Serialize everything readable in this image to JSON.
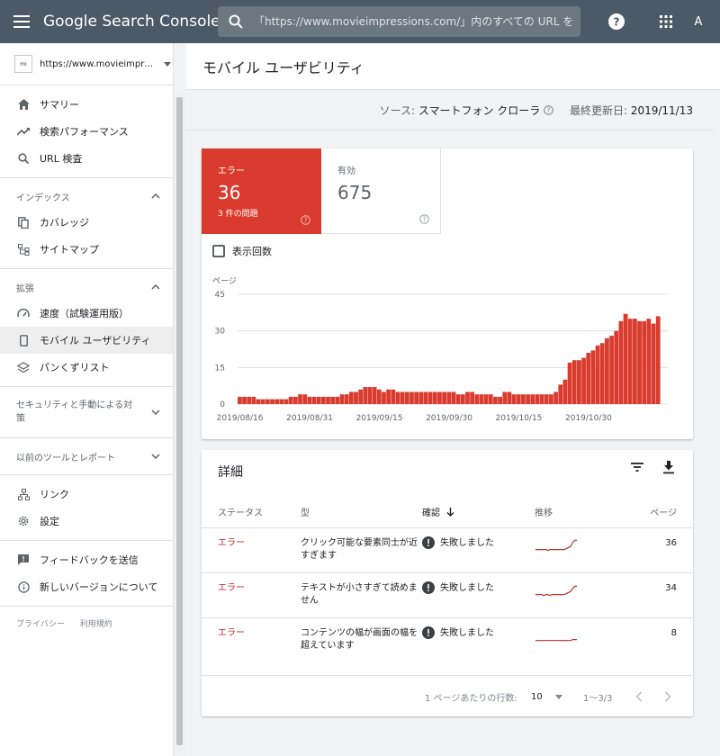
{
  "app": {
    "title": "Google Search Console",
    "avatar_letter": "A",
    "search_placeholder": "「https://www.movieimpressions.com/」内のすべての URL を"
  },
  "sidebar": {
    "property": "https://www.movieimpressions.com/",
    "property_logo_text": "mi",
    "top_items": [
      {
        "label": "サマリー",
        "icon": "home-icon"
      },
      {
        "label": "検索パフォーマンス",
        "icon": "trending-up-icon"
      },
      {
        "label": "URL 検査",
        "icon": "search-icon"
      }
    ],
    "sections": [
      {
        "title": "インデックス",
        "items": [
          {
            "label": "カバレッジ",
            "icon": "copy-icon"
          },
          {
            "label": "サイトマップ",
            "icon": "sitemap-icon"
          }
        ]
      },
      {
        "title": "拡張",
        "items": [
          {
            "label": "速度（試験運用版）",
            "icon": "speedometer-icon"
          },
          {
            "label": "モバイル ユーザビリティ",
            "icon": "smartphone-icon",
            "active": true
          },
          {
            "label": "パンくずリスト",
            "icon": "layers-icon"
          }
        ]
      }
    ],
    "security_section": "セキュリティと手動による対策",
    "legacy_section": "以前のツールとレポート",
    "bottom_items": [
      {
        "label": "リンク",
        "icon": "network-icon"
      },
      {
        "label": "設定",
        "icon": "gear-icon"
      }
    ],
    "feedback_items": [
      {
        "label": "フィードバックを送信",
        "icon": "feedback-icon"
      },
      {
        "label": "新しいバージョンについて",
        "icon": "info-icon"
      }
    ],
    "footer": {
      "privacy": "プライバシー",
      "terms": "利用規約"
    }
  },
  "page": {
    "title": "モバイル ユーザビリティ",
    "source_label": "ソース:",
    "source_value": "スマートフォン クローラ",
    "updated_label": "最終更新日:",
    "updated_value": "2019/11/13"
  },
  "tiles": {
    "error": {
      "label": "エラー",
      "count": "36",
      "sub": "3 件の問題"
    },
    "valid": {
      "label": "有効",
      "count": "675"
    }
  },
  "checkbox_label": "表示回数",
  "colors": {
    "error": "#d93c2f",
    "topbar": "#4b5a66",
    "trend": "#b0322a"
  },
  "chart_data": {
    "type": "bar",
    "ylabel": "ページ",
    "ylim": [
      0,
      45
    ],
    "yticks": [
      0,
      15,
      30,
      45
    ],
    "xtick_labels": [
      "2019/08/16",
      "2019/08/31",
      "2019/09/15",
      "2019/09/30",
      "2019/10/15",
      "2019/10/30"
    ],
    "xtick_indices": [
      0,
      15,
      30,
      45,
      60,
      75
    ],
    "values": [
      3,
      3,
      3,
      3,
      2,
      2,
      2,
      2,
      2,
      2,
      2,
      3,
      3,
      4,
      4,
      3,
      3,
      3,
      3,
      3,
      3,
      3,
      4,
      4,
      5,
      5,
      6,
      7,
      7,
      7,
      6,
      5,
      6,
      6,
      5,
      5,
      5,
      5,
      5,
      5,
      5,
      5,
      5,
      5,
      5,
      5,
      5,
      4,
      4,
      5,
      5,
      4,
      4,
      4,
      4,
      3,
      3,
      5,
      5,
      4,
      4,
      4,
      4,
      4,
      4,
      4,
      4,
      4,
      5,
      8,
      10,
      17,
      18,
      18,
      19,
      21,
      22,
      24,
      25,
      27,
      28,
      30,
      34,
      37,
      35,
      35,
      34,
      34,
      35,
      33,
      36
    ]
  },
  "details": {
    "title": "詳細",
    "columns": {
      "status": "ステータス",
      "type": "型",
      "verify": "確認",
      "trend": "推移",
      "pages": "ページ"
    },
    "rows": [
      {
        "status": "エラー",
        "type": "クリック可能な要素同士が近すぎます",
        "verify": "失敗しました",
        "pages": "36",
        "trend": [
          3,
          3,
          3,
          3,
          3,
          3,
          2,
          3,
          3,
          3,
          3,
          3,
          3,
          3,
          3,
          4,
          5,
          6,
          10,
          12,
          12
        ]
      },
      {
        "status": "エラー",
        "type": "テキストが小さすぎて読めません",
        "verify": "失敗しました",
        "pages": "34",
        "trend": [
          3,
          3,
          3,
          3,
          2,
          3,
          3,
          2,
          3,
          3,
          3,
          3,
          3,
          3,
          3,
          4,
          5,
          6,
          9,
          11,
          11
        ]
      },
      {
        "status": "エラー",
        "type": "コンテンツの幅が画面の幅を超えています",
        "verify": "失敗しました",
        "pages": "8",
        "trend": [
          2,
          2,
          2,
          2,
          2,
          2,
          2,
          2,
          2,
          2,
          2,
          2,
          2,
          2,
          2,
          2,
          2,
          2,
          3,
          3,
          3
        ]
      }
    ],
    "pagination": {
      "rows_per_page_label": "1 ページあたりの行数:",
      "rows_per_page": "10",
      "range": "1〜3/3"
    }
  }
}
